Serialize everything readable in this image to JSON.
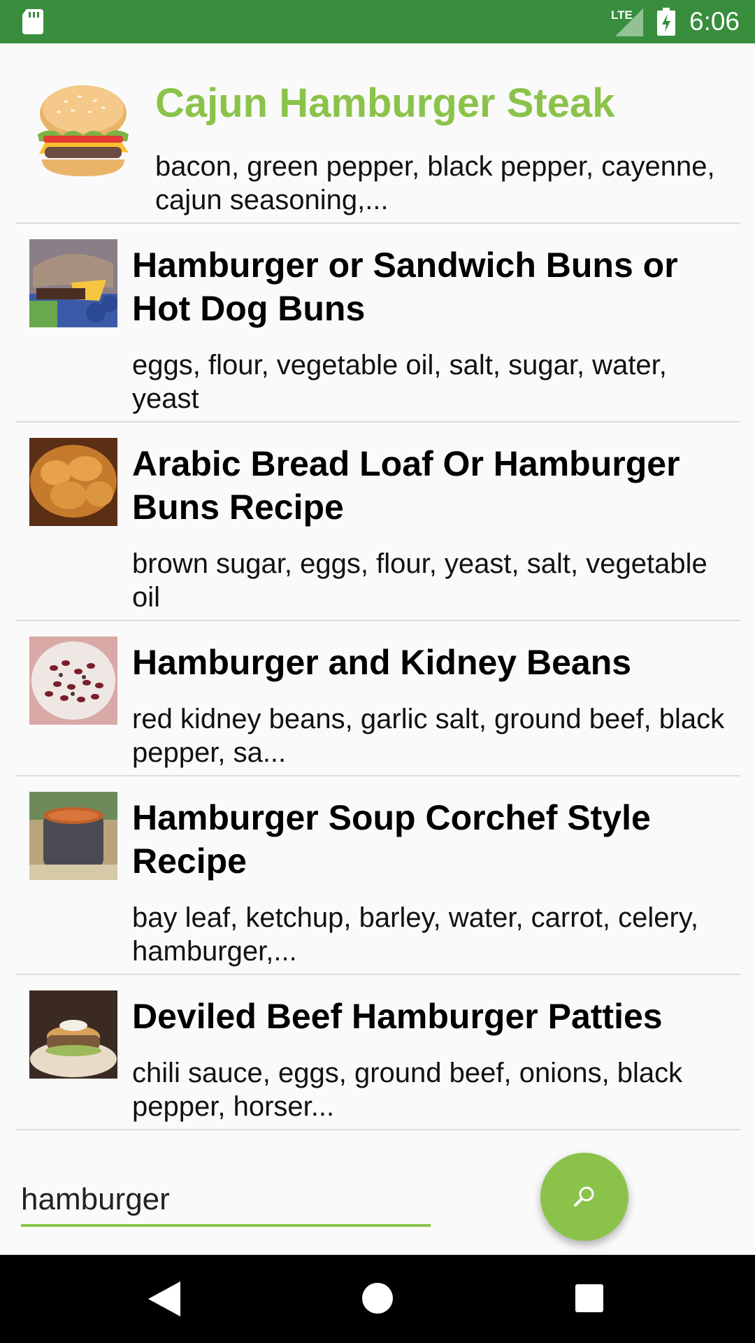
{
  "status_bar": {
    "network": "LTE",
    "time": "6:06"
  },
  "featured": {
    "title": "Cajun Hamburger Steak",
    "ingredients": "bacon, green pepper, black pepper, cayenne, cajun seasoning,...",
    "image_icon": "hamburger-illustration"
  },
  "recipes": [
    {
      "title": "Hamburger or Sandwich Buns or Hot Dog Buns",
      "ingredients": "eggs, flour, vegetable oil, salt, sugar, water, yeast"
    },
    {
      "title": "Arabic Bread Loaf Or Hamburger Buns Recipe",
      "ingredients": "brown sugar, eggs, flour, yeast, salt, vegetable oil"
    },
    {
      "title": "Hamburger and Kidney Beans",
      "ingredients": "red kidney beans, garlic salt, ground beef, black pepper, sa..."
    },
    {
      "title": "Hamburger Soup Corchef Style Recipe",
      "ingredients": "bay leaf, ketchup, barley, water, carrot, celery, hamburger,..."
    },
    {
      "title": "Deviled Beef Hamburger Patties",
      "ingredients": "chili sauce, eggs, ground beef, onions, black pepper, horser..."
    }
  ],
  "search": {
    "value": "hamburger",
    "button_icon": "search-icon"
  },
  "colors": {
    "status_bar": "#388e3c",
    "accent": "#8bc34a",
    "nav_bar": "#000000"
  }
}
